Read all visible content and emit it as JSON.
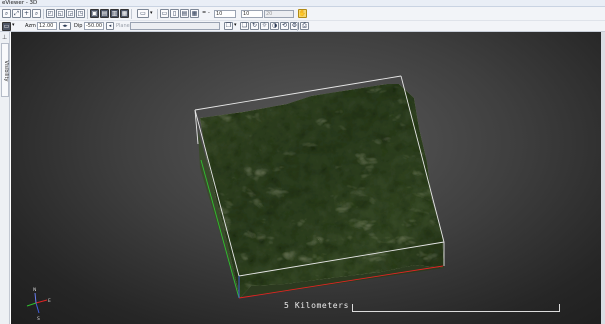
{
  "window": {
    "title": "eViewer - 3D"
  },
  "toolbar1": {
    "field_a_value": "10",
    "field_b_value": "10",
    "field_c_value": "20"
  },
  "toolbar2": {
    "azm_label": "Azm",
    "azm_value": "12.00",
    "dip_label": "Dip",
    "dip_value": "-50.00",
    "plane_label": "Plane",
    "plane_value": ""
  },
  "sidebar": {
    "tab_label": "Visibility"
  },
  "viewport": {
    "scalebar_label": "5 Kilometers",
    "colors": {
      "x_axis": "#e02424",
      "y_axis": "#2fbf2f",
      "z_axis": "#3f5fe0",
      "bbox": "#e6e6e6"
    },
    "compass": {
      "north": "N",
      "east": "E",
      "south": "S"
    }
  }
}
